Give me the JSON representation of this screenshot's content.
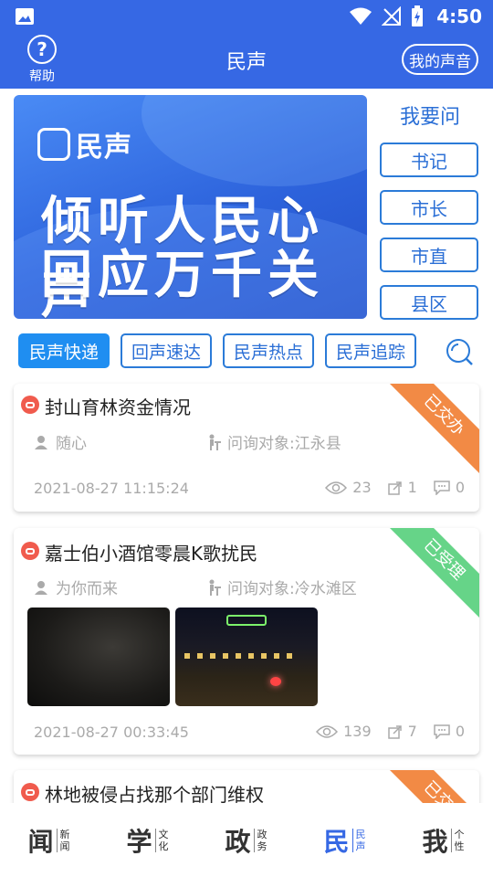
{
  "status_bar": {
    "time": "4:50"
  },
  "header": {
    "help_label": "帮助",
    "help_glyph": "?",
    "title": "民声",
    "my_voice_label": "我的声音"
  },
  "banner": {
    "logo_text": "民声",
    "slogan_line1": "倾听人民心声",
    "slogan_line2": "回应万千关切"
  },
  "ask": {
    "title": "我要问",
    "buttons": [
      "书记",
      "市长",
      "市直",
      "县区"
    ]
  },
  "tabs": [
    {
      "label": "民声快递",
      "active": true
    },
    {
      "label": "回声速达",
      "active": false
    },
    {
      "label": "民声热点",
      "active": false
    },
    {
      "label": "民声追踪",
      "active": false
    }
  ],
  "posts": [
    {
      "title": "封山育林资金情况",
      "author": "随心",
      "target": "问询对象:江永县",
      "date": "2021-08-27 11:15:24",
      "views": "23",
      "shares": "1",
      "comments": "0",
      "status": "已交办",
      "status_color": "#f28a45"
    },
    {
      "title": "嘉士伯小酒馆零晨K歌扰民",
      "author": "为你而来",
      "target": "问询对象:冷水滩区",
      "date": "2021-08-27 00:33:45",
      "views": "139",
      "shares": "7",
      "comments": "0",
      "status": "已受理",
      "status_color": "#66d488"
    },
    {
      "title": "林地被侵占找那个部门维权",
      "status": "已交办",
      "status_color": "#f28a45"
    }
  ],
  "bottom_nav": [
    {
      "big": "闻",
      "small1": "新",
      "small2": "闻",
      "active": false
    },
    {
      "big": "学",
      "small1": "文",
      "small2": "化",
      "active": false
    },
    {
      "big": "政",
      "small1": "政",
      "small2": "务",
      "active": false
    },
    {
      "big": "民",
      "small1": "民",
      "small2": "声",
      "active": true
    },
    {
      "big": "我",
      "small1": "个",
      "small2": "性",
      "active": false
    }
  ],
  "colors": {
    "primary": "#3668e4",
    "accent": "#1f8ef1",
    "badge_red": "#f05b4d"
  }
}
